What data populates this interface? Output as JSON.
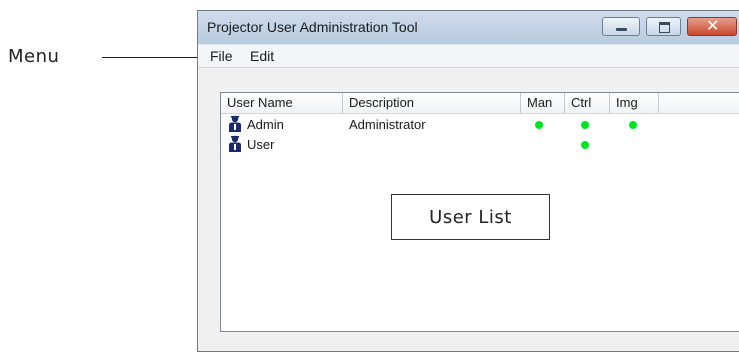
{
  "annotations": {
    "menu_label": "Menu",
    "user_list_label": "User List"
  },
  "window": {
    "title": "Projector User Administration Tool",
    "controls": [
      "minimize",
      "maximize",
      "close"
    ]
  },
  "menubar": {
    "items": [
      {
        "label": "File"
      },
      {
        "label": "Edit"
      }
    ]
  },
  "user_list": {
    "columns": [
      "User Name",
      "Description",
      "Man",
      "Ctrl",
      "Img"
    ],
    "rows": [
      {
        "name": "Admin",
        "description": "Administrator",
        "man": true,
        "ctrl": true,
        "img": true
      },
      {
        "name": "User",
        "description": "",
        "man": false,
        "ctrl": true,
        "img": false
      }
    ],
    "indicator_color": "#00e61e",
    "icon": "user-icon"
  }
}
